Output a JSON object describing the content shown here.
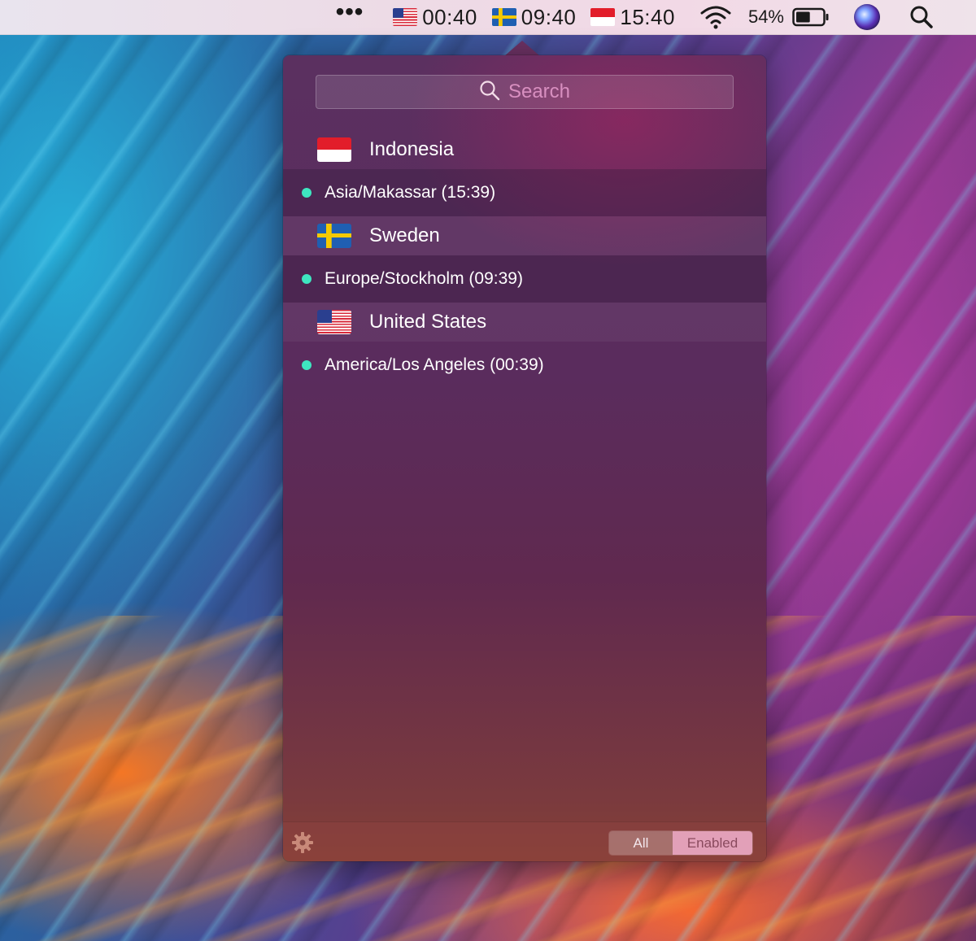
{
  "menubar": {
    "more_label": "•••",
    "clocks": [
      {
        "flag": "flag-us",
        "time": "00:40"
      },
      {
        "flag": "flag-se",
        "time": "09:40"
      },
      {
        "flag": "flag-id",
        "time": "15:40"
      }
    ],
    "battery_percent": "54%",
    "battery_level": 0.54,
    "icons": [
      "wifi-icon",
      "battery-icon",
      "siri-icon",
      "spotlight-search-icon"
    ]
  },
  "popover": {
    "search": {
      "placeholder": "Search"
    },
    "groups": [
      {
        "country": "Indonesia",
        "flag": "flag-id",
        "zones": [
          {
            "label": "Asia/Makassar (15:39)",
            "enabled": true
          }
        ]
      },
      {
        "country": "Sweden",
        "flag": "flag-se",
        "zones": [
          {
            "label": "Europe/Stockholm (09:39)",
            "enabled": true
          }
        ]
      },
      {
        "country": "United States",
        "flag": "flag-us",
        "zones": [
          {
            "label": "America/Los Angeles (00:39)",
            "enabled": true
          }
        ]
      }
    ],
    "footer": {
      "filter_options": [
        "All",
        "Enabled"
      ],
      "selected_filter": "Enabled"
    }
  },
  "colors": {
    "enabled_dot": "#3ee6c0",
    "accent_selected": "#e2a0b8"
  }
}
